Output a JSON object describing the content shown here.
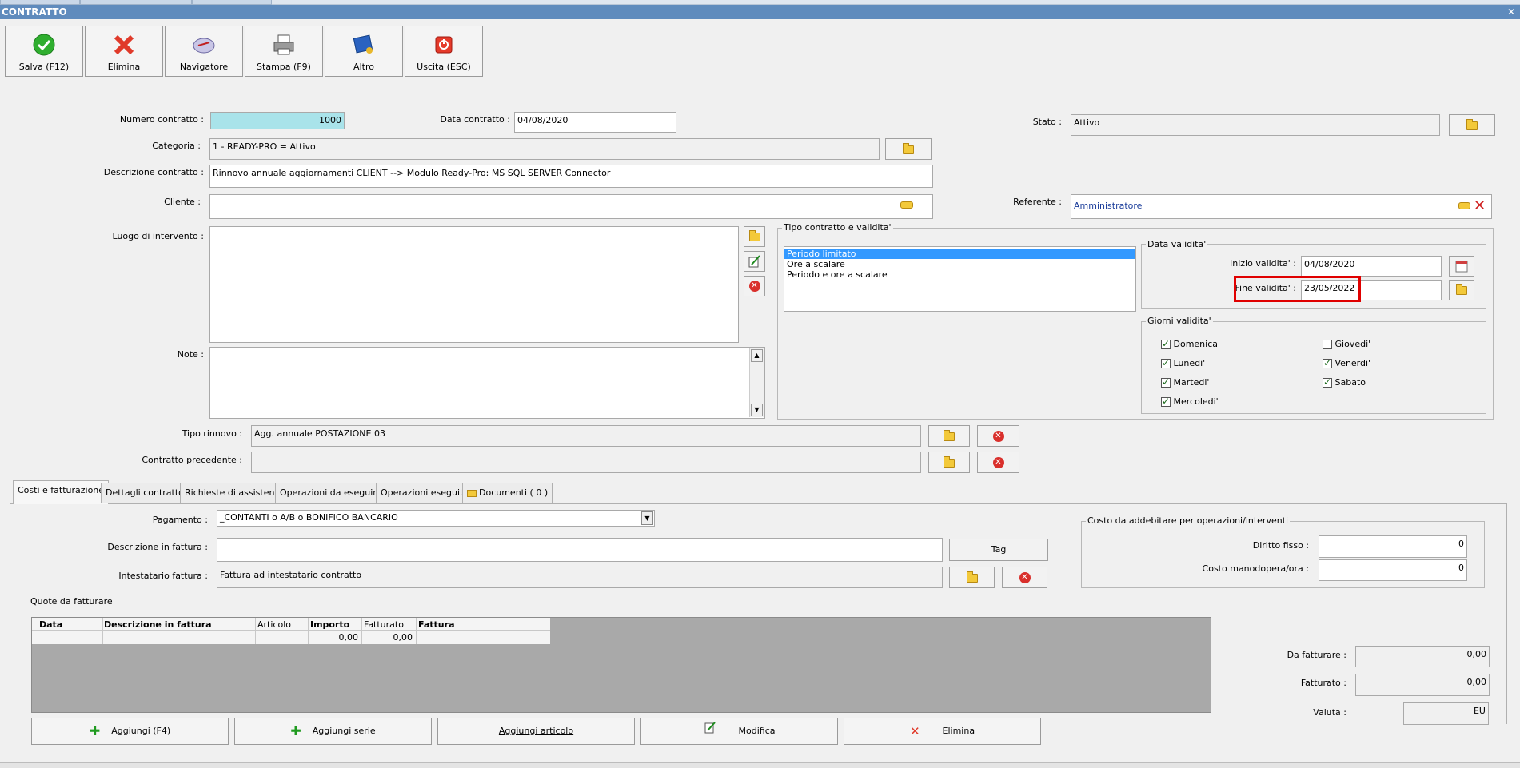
{
  "window": {
    "title": "CONTRATTO",
    "close_label": "✕"
  },
  "toolbar": [
    {
      "label": "Salva (F12)",
      "icon": "check-icon"
    },
    {
      "label": "Elimina",
      "icon": "delete-x-icon"
    },
    {
      "label": "Navigatore",
      "icon": "navigator-icon"
    },
    {
      "label": "Stampa (F9)",
      "icon": "printer-icon"
    },
    {
      "label": "Altro",
      "icon": "other-icon"
    },
    {
      "label": "Uscita (ESC)",
      "icon": "exit-icon"
    }
  ],
  "form": {
    "numero_label": "Numero contratto :",
    "numero_value": "1000",
    "data_label": "Data contratto :",
    "data_value": "04/08/2020",
    "stato_label": "Stato :",
    "stato_value": "Attivo",
    "categoria_label": "Categoria :",
    "categoria_value": "1 - READY-PRO = Attivo",
    "descrizione_label": "Descrizione contratto :",
    "descrizione_value": "Rinnovo annuale aggiornamenti CLIENT --> Modulo Ready-Pro: MS SQL SERVER Connector",
    "cliente_label": "Cliente :",
    "cliente_value": "",
    "referente_label": "Referente :",
    "referente_value": "Amministratore",
    "luogo_label": "Luogo di intervento :",
    "note_label": "Note :",
    "tipo_rinnovo_label": "Tipo rinnovo :",
    "tipo_rinnovo_value": "Agg. annuale POSTAZIONE 03",
    "contratto_prec_label": "Contratto precedente :",
    "contratto_prec_value": ""
  },
  "validity": {
    "group_title": "Tipo contratto e validita'",
    "types": [
      "Periodo limitato",
      "Ore a scalare",
      "Periodo e ore a scalare"
    ],
    "selected_type": "Periodo limitato",
    "data_title": "Data validita'",
    "inizio_label": "Inizio validita' :",
    "inizio_value": "04/08/2020",
    "fine_label": "Fine validita' :",
    "fine_value": "23/05/2022",
    "giorni_title": "Giorni validita'",
    "days": [
      {
        "label": "Domenica",
        "checked": true
      },
      {
        "label": "Lunedi'",
        "checked": true
      },
      {
        "label": "Martedi'",
        "checked": true
      },
      {
        "label": "Mercoledi'",
        "checked": true
      },
      {
        "label": "Giovedi'",
        "checked": false
      },
      {
        "label": "Venerdi'",
        "checked": true
      },
      {
        "label": "Sabato",
        "checked": true
      }
    ]
  },
  "tabs": [
    "Costi e fatturazione",
    "Dettagli contratto",
    "Richieste di assistenza",
    "Operazioni da eseguire",
    "Operazioni eseguite",
    "Documenti ( 0 )"
  ],
  "billing": {
    "pagamento_label": "Pagamento :",
    "pagamento_value": "_CONTANTI o A/B o BONIFICO BANCARIO",
    "desc_fattura_label": "Descrizione in fattura :",
    "desc_fattura_value": "",
    "tag_label": "Tag",
    "intestatario_label": "Intestatario fattura :",
    "intestatario_value": "Fattura ad intestatario contratto",
    "costo_title": "Costo da addebitare per operazioni/interventi",
    "diritto_label": "Diritto fisso :",
    "diritto_value": "0",
    "manodopera_label": "Costo manodopera/ora :",
    "manodopera_value": "0",
    "quote_title": "Quote da fatturare",
    "columns": [
      "Data",
      "Descrizione in fattura",
      "Articolo",
      "Importo",
      "Fatturato",
      "Fattura"
    ],
    "row": [
      "",
      "",
      "",
      "0,00",
      "0,00",
      ""
    ],
    "da_fatturare_label": "Da fatturare :",
    "da_fatturare_value": "0,00",
    "fatturato_label": "Fatturato :",
    "fatturato_value": "0,00",
    "valuta_label": "Valuta :",
    "valuta_value": "EU"
  },
  "bottom_buttons": [
    "Aggiungi (F4)",
    "Aggiungi serie",
    "Aggiungi articolo",
    "Modifica",
    "Elimina"
  ],
  "colors": {
    "title_bar": "#5f8bbd",
    "highlight": "#e00000",
    "selection": "#3399ff",
    "cyan_field": "#a9e3ea"
  }
}
